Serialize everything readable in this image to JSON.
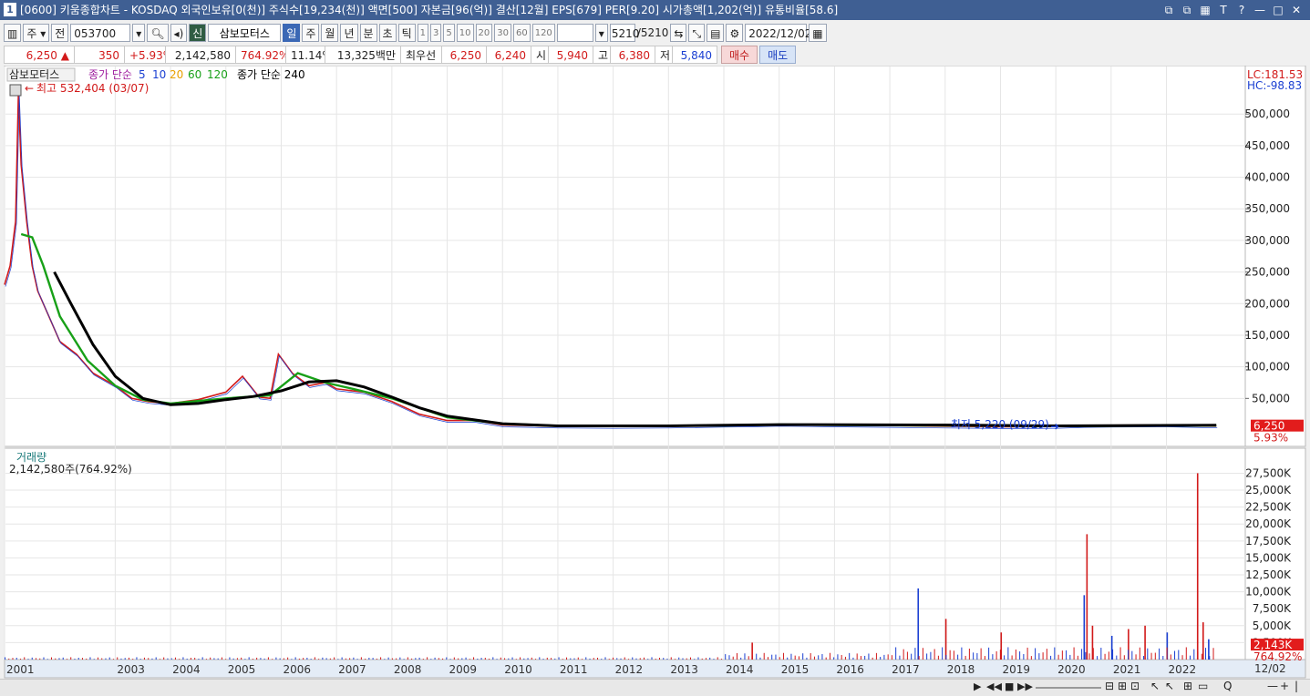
{
  "window": {
    "number": "1",
    "title": "[0600] 키움종합차트 - KOSDAQ 외국인보유[0(천)] 주식수[19,234(천)] 액면[500] 자본금[96(억)] 결산[12월] EPS[679] PER[9.20] 시가총액[1,202(억)] 유통비율[58.6]",
    "controls": [
      "⧉",
      "⧉",
      "▦",
      "T",
      "?",
      "—",
      "□",
      "✕"
    ]
  },
  "toolbar": {
    "type_select": "주",
    "prev_label": "전",
    "code": "053700",
    "badge": "신",
    "stock_name": "삼보모터스",
    "periods": [
      "일",
      "주",
      "월",
      "년",
      "분",
      "초",
      "틱"
    ],
    "active_period": "일",
    "intervals": [
      "1",
      "3",
      "5",
      "10",
      "20",
      "30",
      "60",
      "120"
    ],
    "count": "5210",
    "count_total": "/5210",
    "date": "2022/12/02"
  },
  "quote": {
    "price": "6,250",
    "change": "350",
    "change_pct": "+5.93%",
    "volume": "2,142,580",
    "volume_ratio": "764.92%",
    "turnover": "11.14%",
    "amount": "13,325백만",
    "bid_label": "최우선",
    "bid1": "6,250",
    "bid2": "6,240",
    "open_label": "시",
    "open": "5,940",
    "high_label": "고",
    "high": "6,380",
    "low_label": "저",
    "low": "5,840",
    "buy": "매수",
    "sell": "매도"
  },
  "chart_data": [
    {
      "type": "line",
      "title": "삼보모터스",
      "legend": [
        {
          "name": "삼보모터스",
          "color": "#555555"
        },
        {
          "name": "종가 단순",
          "color": "#a020a0"
        },
        {
          "name": "5",
          "color": "#1a3fd2"
        },
        {
          "name": "10",
          "color": "#1a3fd2"
        },
        {
          "name": "20",
          "color": "#e8a000"
        },
        {
          "name": "60",
          "color": "#18a018"
        },
        {
          "name": "120",
          "color": "#a020a0"
        },
        {
          "name": "종가 단순 240",
          "color": "#000000"
        }
      ],
      "annotations": {
        "max_label": "최고 532,404 (03/07)",
        "min_label": "최저 5,220 (09/29)",
        "lc": "LC:181.53",
        "hc": "HC:-98.83",
        "last_price": "6,250",
        "last_change": "5.93%"
      },
      "y_ticks": [
        "500,000",
        "450,000",
        "400,000",
        "350,000",
        "300,000",
        "250,000",
        "200,000",
        "150,000",
        "100,000",
        "50,000"
      ],
      "ylim": [
        0,
        545000
      ],
      "x_ticks": [
        "2001",
        "2003",
        "2004",
        "2005",
        "2006",
        "2007",
        "2008",
        "2009",
        "2010",
        "2011",
        "2012",
        "2013",
        "2014",
        "2015",
        "2016",
        "2017",
        "2018",
        "2019",
        "2020",
        "2021",
        "2022"
      ],
      "x_end_label": "12/02",
      "price_series": {
        "name": "종가",
        "x": [
          2001.0,
          2001.1,
          2001.2,
          2001.25,
          2001.3,
          2001.4,
          2001.5,
          2001.6,
          2001.8,
          2002.0,
          2002.3,
          2002.6,
          2003.0,
          2003.3,
          2003.6,
          2004.0,
          2004.5,
          2005.0,
          2005.3,
          2005.6,
          2005.8,
          2005.95,
          2006.2,
          2006.5,
          2006.8,
          2007.0,
          2007.5,
          2008.0,
          2008.5,
          2009.0,
          2009.5,
          2010.0,
          2010.5,
          2011.0,
          2012.0,
          2013.0,
          2014.0,
          2014.5,
          2015.0,
          2016.0,
          2017.0,
          2018.0,
          2019.0,
          2020.0,
          2020.5,
          2021.0,
          2022.0,
          2022.9
        ],
        "y": [
          230000,
          260000,
          330000,
          532404,
          420000,
          330000,
          260000,
          220000,
          180000,
          140000,
          120000,
          90000,
          70000,
          50000,
          45000,
          42000,
          48000,
          60000,
          85000,
          52000,
          50000,
          120000,
          90000,
          70000,
          75000,
          65000,
          60000,
          45000,
          25000,
          15000,
          15000,
          8000,
          7000,
          6000,
          5500,
          6000,
          7500,
          8000,
          9000,
          8000,
          7000,
          6000,
          5220,
          5500,
          7000,
          7500,
          8000,
          6250
        ]
      },
      "ma_series": [
        {
          "name": "60",
          "color": "#18a018",
          "x": [
            2001.3,
            2001.5,
            2001.7,
            2002.0,
            2002.5,
            2003.0,
            2003.5,
            2004.0,
            2005.0,
            2005.8,
            2006.3,
            2006.8,
            2007.3,
            2008.0,
            2009.0,
            2010.0,
            2011.0,
            2014.0,
            2015.0,
            2018.0,
            2020.0,
            2022.9
          ],
          "y": [
            310000,
            305000,
            260000,
            180000,
            110000,
            70000,
            48000,
            42000,
            50000,
            55000,
            90000,
            75000,
            65000,
            50000,
            20000,
            10000,
            6500,
            7000,
            8500,
            7000,
            6000,
            7000
          ]
        },
        {
          "name": "240",
          "color": "#000000",
          "x": [
            2001.9,
            2002.2,
            2002.6,
            2003.0,
            2003.5,
            2004.0,
            2004.5,
            2005.0,
            2005.5,
            2006.0,
            2006.5,
            2007.0,
            2007.5,
            2008.0,
            2008.5,
            2009.0,
            2010.0,
            2011.0,
            2013.0,
            2015.0,
            2018.0,
            2020.0,
            2022.9
          ],
          "y": [
            250000,
            200000,
            135000,
            85000,
            50000,
            40000,
            42000,
            48000,
            53000,
            62000,
            76000,
            78000,
            68000,
            52000,
            35000,
            22000,
            10000,
            6500,
            6500,
            8500,
            8000,
            6500,
            7500
          ]
        }
      ],
      "price_colors": {
        "up": "#d21a1a",
        "down": "#1a3fd2",
        "grid": "#e6e6e6",
        "ma60": "#18a018",
        "ma240": "#000000"
      }
    },
    {
      "type": "bar",
      "title": "거래량",
      "label": "2,142,580주(764.92%)",
      "y_ticks": [
        "27,500K",
        "25,000K",
        "22,500K",
        "20,000K",
        "17,500K",
        "15,000K",
        "12,500K",
        "10,000K",
        "7,500K",
        "5,000K",
        "2,500K"
      ],
      "ylim": [
        0,
        28500
      ],
      "last_volume": "2,143K",
      "last_ratio": "764.92%",
      "spikes": {
        "x": [
          2014.5,
          2017.5,
          2018.0,
          2019.0,
          2020.5,
          2020.55,
          2020.65,
          2021.0,
          2021.3,
          2021.6,
          2022.0,
          2022.55,
          2022.65,
          2022.75
        ],
        "y": [
          2500,
          10500,
          6000,
          4000,
          9500,
          18500,
          5000,
          3500,
          4500,
          5000,
          4000,
          27500,
          5500,
          3000
        ]
      }
    }
  ],
  "bottom": {
    "date_label": "12/02",
    "nav": [
      "▶",
      "◀◀",
      "■",
      "▶▶"
    ],
    "tools": [
      "⊟",
      "⊞",
      "⊡",
      "↖",
      "↖",
      "⊞",
      "▭",
      "Q",
      "—",
      "+",
      "|"
    ]
  }
}
